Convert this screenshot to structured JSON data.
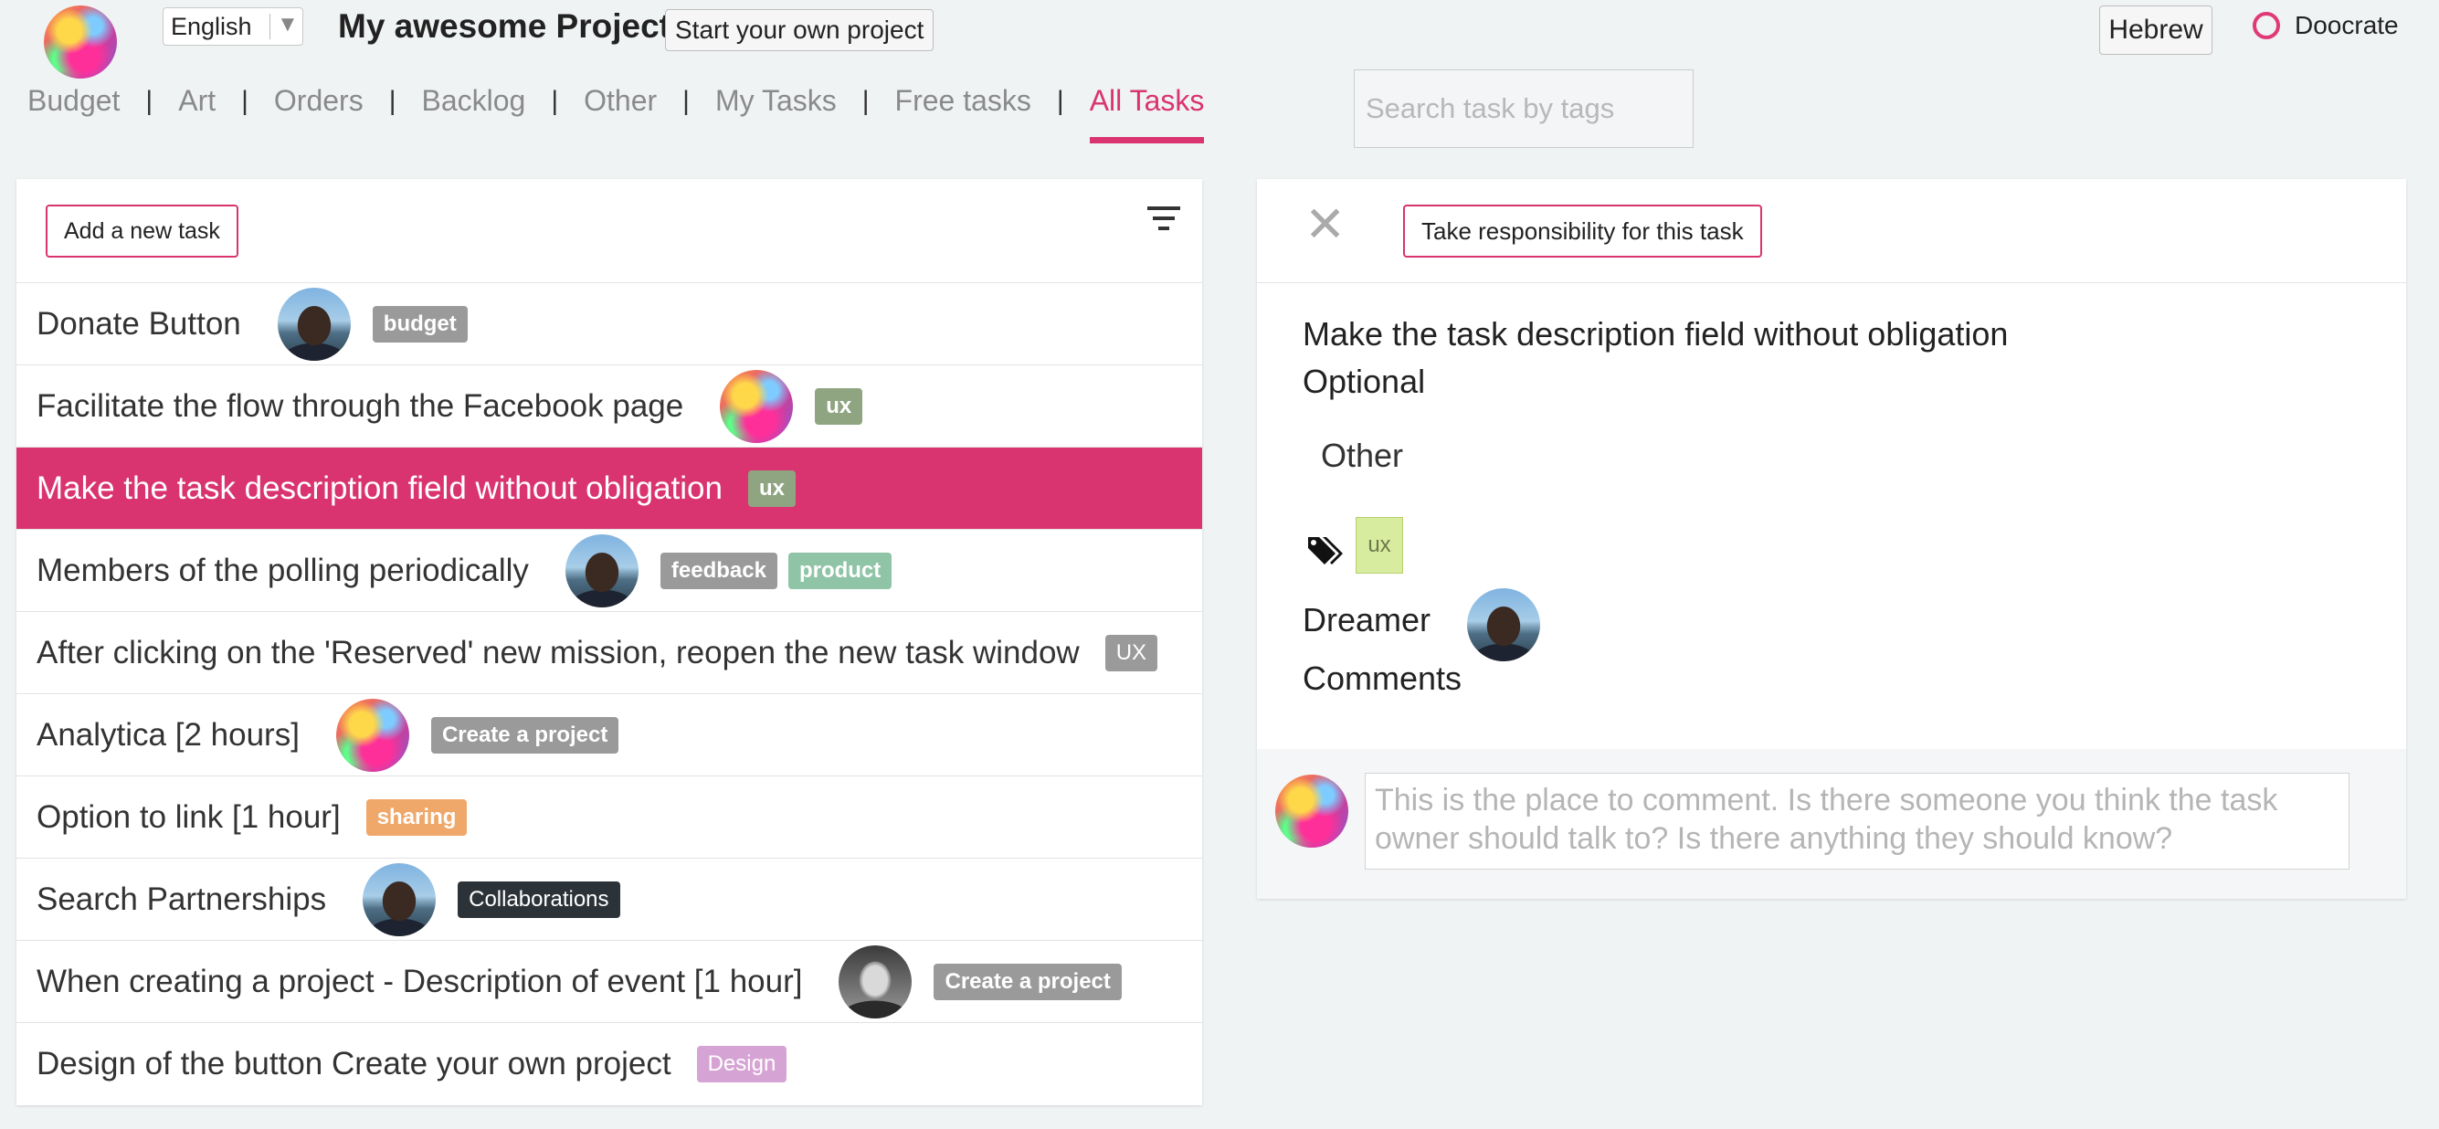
{
  "header": {
    "language": "English",
    "project_title": "My awesome Project",
    "start_project_label": "Start your own project",
    "hebrew_label": "Hebrew",
    "brand": "Doocrate"
  },
  "nav": {
    "tabs": [
      {
        "label": "Budget"
      },
      {
        "label": "Art"
      },
      {
        "label": "Orders"
      },
      {
        "label": "Backlog"
      },
      {
        "label": "Other"
      },
      {
        "label": "My Tasks"
      },
      {
        "label": "Free tasks"
      },
      {
        "label": "All Tasks",
        "active": true
      }
    ],
    "search_placeholder": "Search task by tags"
  },
  "task_list": {
    "add_task_label": "Add a new task",
    "filter_icon": "filter-icon",
    "tasks": [
      {
        "title": "Donate Button",
        "avatar": "photo",
        "tags": [
          {
            "label": "budget",
            "color": "#9a9a9a"
          }
        ]
      },
      {
        "title": "Facilitate the flow through the Facebook page",
        "avatar": "color",
        "tags": [
          {
            "label": "ux",
            "color": "#8fa581"
          }
        ]
      },
      {
        "title": "Make the task description field without obligation",
        "avatar": null,
        "selected": true,
        "tags": [
          {
            "label": "ux",
            "color": "#8fa581"
          }
        ]
      },
      {
        "title": "Members of the polling periodically",
        "avatar": "photo",
        "tags": [
          {
            "label": "feedback",
            "color": "#9a9a9a"
          },
          {
            "label": "product",
            "color": "#8fc4a6"
          }
        ]
      },
      {
        "title": "After clicking on the 'Reserved' new mission, reopen the new task window",
        "avatar": null,
        "tags": [
          {
            "label": "UX",
            "color": "#9a9a9a"
          }
        ]
      },
      {
        "title": "Analytica [2 hours]",
        "avatar": "color",
        "tags": [
          {
            "label": "Create a project",
            "color": "#9a9a9a"
          }
        ]
      },
      {
        "title": "Option to link [1 hour]",
        "avatar": null,
        "tags": [
          {
            "label": "sharing",
            "color": "#f0a86a"
          }
        ]
      },
      {
        "title": "Search Partnerships",
        "avatar": "photo",
        "tags": [
          {
            "label": "Collaborations",
            "color": "#2c3338"
          }
        ]
      },
      {
        "title": "When creating a project - Description of event [1 hour]",
        "avatar": "bw",
        "tags": [
          {
            "label": "Create a project",
            "color": "#9a9a9a"
          }
        ]
      },
      {
        "title": "Design of the button Create your own project",
        "avatar": null,
        "tags": [
          {
            "label": "Design",
            "color": "#d6a4d4"
          }
        ]
      }
    ]
  },
  "detail": {
    "close_icon": "close-icon",
    "take_responsibility_label": "Take responsibility for this task",
    "description": "Make the task description field without obligation Optional",
    "category": "Other",
    "tag_icon": "tag-icon",
    "tag": "ux",
    "dreamer_label": "Dreamer",
    "comments_label": "Comments",
    "comment_placeholder": "This is the place to comment. Is there someone you think the task owner should talk to? Is there anything they should know?"
  },
  "colors": {
    "accent": "#d9346f",
    "background": "#f0f3f4"
  }
}
